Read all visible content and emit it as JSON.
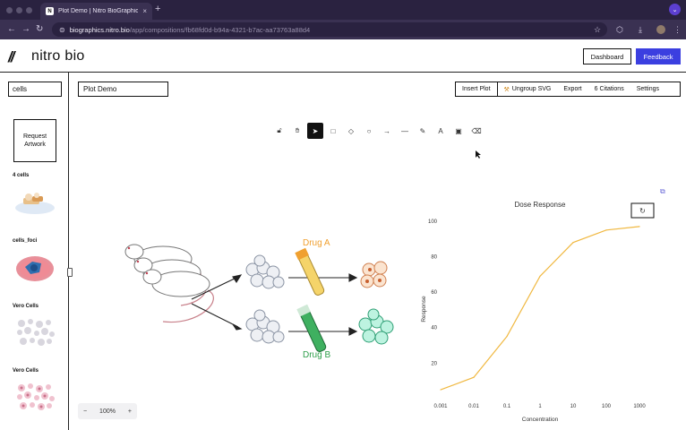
{
  "browser": {
    "tab_title": "Plot Demo | Nitro BioGraphics",
    "favicon_text": "N",
    "url_host": "biographics.nitro.bio",
    "url_path": "/app/compositions/fb68fd0d-b94a-4321-b7ac-aa73763a88d4"
  },
  "header": {
    "logo_text": "nitro bio",
    "dashboard_label": "Dashboard",
    "feedback_label": "Feedback"
  },
  "sidebar": {
    "search_value": "cells",
    "request_artwork_label": "Request Artwork",
    "assets": [
      {
        "label": "4 cells"
      },
      {
        "label": "cells_foci"
      },
      {
        "label": "Vero Cells"
      },
      {
        "label": "Vero Cells"
      }
    ]
  },
  "doc": {
    "title": "Plot Demo"
  },
  "toolbar": {
    "insert_plot": "Insert Plot",
    "ungroup_svg": "Ungroup SVG",
    "export": "Export",
    "citations": "6 Citations",
    "settings": "Settings"
  },
  "tools": [
    {
      "name": "lock-tool",
      "icon": "lock-icon"
    },
    {
      "name": "hand-tool",
      "icon": "hand-icon"
    },
    {
      "name": "select-tool",
      "icon": "cursor-icon",
      "active": true
    },
    {
      "name": "rectangle-tool",
      "icon": "square-icon"
    },
    {
      "name": "diamond-tool",
      "icon": "diamond-icon"
    },
    {
      "name": "ellipse-tool",
      "icon": "circle-icon"
    },
    {
      "name": "arrow-tool",
      "icon": "arrow-icon"
    },
    {
      "name": "line-tool",
      "icon": "line-icon"
    },
    {
      "name": "pencil-tool",
      "icon": "pencil-icon"
    },
    {
      "name": "text-tool",
      "icon": "text-icon"
    },
    {
      "name": "image-tool",
      "icon": "image-icon"
    },
    {
      "name": "eraser-tool",
      "icon": "eraser-icon"
    }
  ],
  "diagram": {
    "drug_a": "Drug A",
    "drug_b": "Drug B",
    "drug_a_color": "#f0a030",
    "drug_b_color": "#2e9e4a"
  },
  "zoom": {
    "minus": "−",
    "value": "100%",
    "plus": "+"
  },
  "chart_data": {
    "type": "line",
    "title": "Dose Response",
    "xlabel": "Concentration",
    "ylabel": "Response",
    "xscale": "log",
    "x_ticks": [
      "0.001",
      "0.01",
      "0.1",
      "1",
      "10",
      "100",
      "1000"
    ],
    "y_ticks": [
      20,
      40,
      60,
      80,
      100
    ],
    "ylim": [
      2,
      104
    ],
    "xlim": [
      0.001,
      1000
    ],
    "series": [
      {
        "color": "#f0b840",
        "x": [
          0.001,
          0.01,
          0.1,
          1,
          10,
          100,
          1000
        ],
        "y": [
          5,
          12,
          35,
          69,
          88,
          95,
          97
        ]
      }
    ],
    "grid": false
  }
}
